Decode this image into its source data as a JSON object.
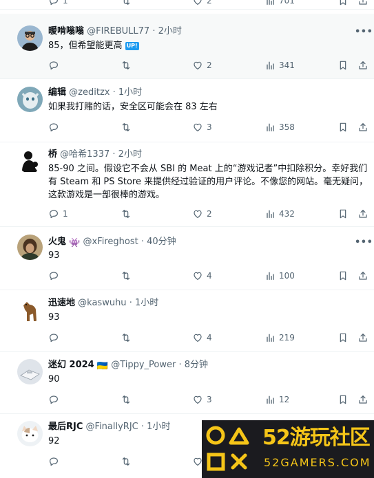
{
  "tweets": [
    {
      "name": "",
      "handle": "",
      "time": "",
      "text": "",
      "reply": "1",
      "retweet": "",
      "like": "2",
      "views": "701"
    },
    {
      "name": "暖啃嗡嗡",
      "handle": "@FIREBULL77",
      "sep": "·",
      "time": "2小时",
      "text": "85，但希望能更高",
      "badge": "UP!",
      "reply": "",
      "retweet": "",
      "like": "2",
      "views": "341"
    },
    {
      "name": "编辑",
      "handle": "@zeditzx",
      "sep": "·",
      "time": "1小时",
      "text": "如果我打赌的话，安全区可能会在 83 左右",
      "reply": "",
      "retweet": "",
      "like": "3",
      "views": "358"
    },
    {
      "name": "桥",
      "handle": "@哈希1337",
      "sep": "·",
      "time": "2小时",
      "text": "85-90 之间。假设它不会从 SBI 的 Meat 上的“游戏记者”中扣除积分。幸好我们有 Steam 和 PS Store 来提供经过验证的用户评论。不像您的网站。毫无疑问，这款游戏是一部很棒的游戏。",
      "reply": "1",
      "retweet": "",
      "like": "2",
      "views": "432"
    },
    {
      "name": "火鬼",
      "emoji": "👾",
      "handle": "@xFireghost",
      "sep": "·",
      "time": "40分钟",
      "text": "93",
      "reply": "",
      "retweet": "",
      "like": "4",
      "views": "100"
    },
    {
      "name": "迅速地",
      "handle": "@kaswuhu",
      "sep": "·",
      "time": "1小时",
      "text": "93",
      "reply": "",
      "retweet": "",
      "like": "4",
      "views": "219"
    },
    {
      "name": "迷幻 2024",
      "flag": "🇺🇦",
      "handle": "@Tippy_Power",
      "sep": "·",
      "time": "8分钟",
      "text": "90",
      "reply": "",
      "retweet": "",
      "like": "3",
      "views": "12"
    },
    {
      "name": "最后RJC",
      "handle": "@FinallyRJC",
      "sep": "·",
      "time": "1小时",
      "text": "92",
      "reply": "",
      "retweet": "",
      "like": "",
      "views": ""
    }
  ],
  "more_label": "•••",
  "watermark": {
    "line1": "52游玩社区",
    "line2": "52GAMERS.COM"
  },
  "colors": {
    "text": "#0f1419",
    "muted": "#536471",
    "accent": "#1d9bf0",
    "watermark": "#f5c518"
  },
  "icons": [
    "reply-icon",
    "retweet-icon",
    "like-icon",
    "views-icon",
    "bookmark-icon",
    "share-icon",
    "more-icon"
  ]
}
